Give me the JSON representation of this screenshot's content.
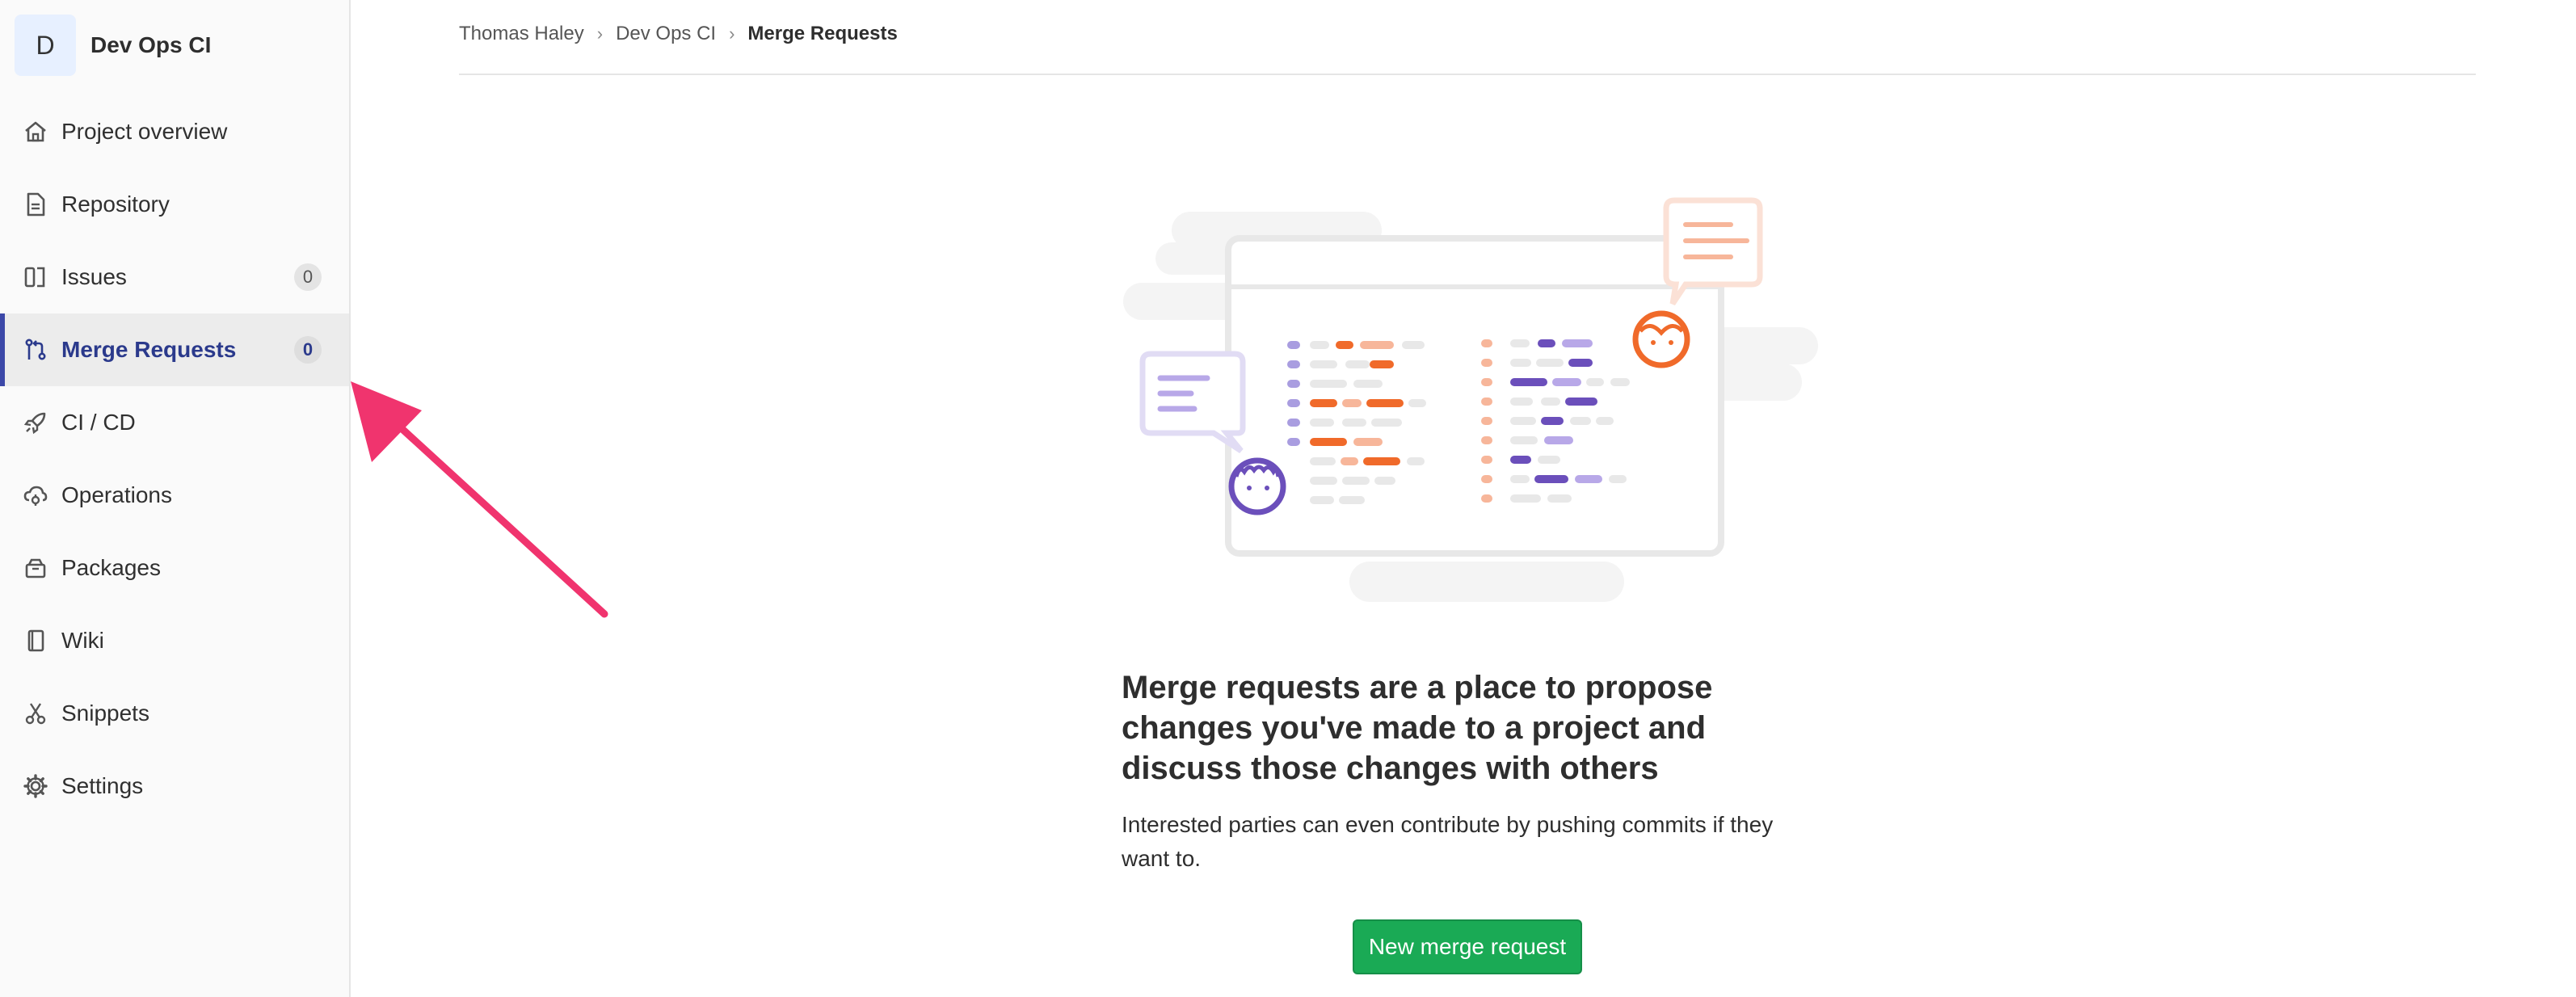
{
  "project": {
    "avatar_letter": "D",
    "name": "Dev Ops CI"
  },
  "sidebar": {
    "items": [
      {
        "label": "Project overview",
        "icon": "home-icon"
      },
      {
        "label": "Repository",
        "icon": "document-icon"
      },
      {
        "label": "Issues",
        "icon": "issues-icon",
        "count": "0"
      },
      {
        "label": "Merge Requests",
        "icon": "merge-request-icon",
        "count": "0",
        "active": true
      },
      {
        "label": "CI / CD",
        "icon": "rocket-icon"
      },
      {
        "label": "Operations",
        "icon": "cloud-gear-icon"
      },
      {
        "label": "Packages",
        "icon": "package-icon"
      },
      {
        "label": "Wiki",
        "icon": "book-icon"
      },
      {
        "label": "Snippets",
        "icon": "scissors-icon"
      },
      {
        "label": "Settings",
        "icon": "gear-icon"
      }
    ]
  },
  "breadcrumb": {
    "items": [
      "Thomas Haley",
      "Dev Ops CI",
      "Merge Requests"
    ],
    "separator": "›"
  },
  "empty_state": {
    "title": "Merge requests are a place to propose changes you've made to a project and discuss those changes with others",
    "description": "Interested parties can even contribute by pushing commits if they want to.",
    "button_label": "New merge request"
  },
  "colors": {
    "accent_active": "#3c48a8",
    "button_green": "#1aaa55",
    "annotation_arrow": "#f0346e",
    "illustration_orange": "#f06a2a",
    "illustration_purple": "#6b4fbb"
  }
}
